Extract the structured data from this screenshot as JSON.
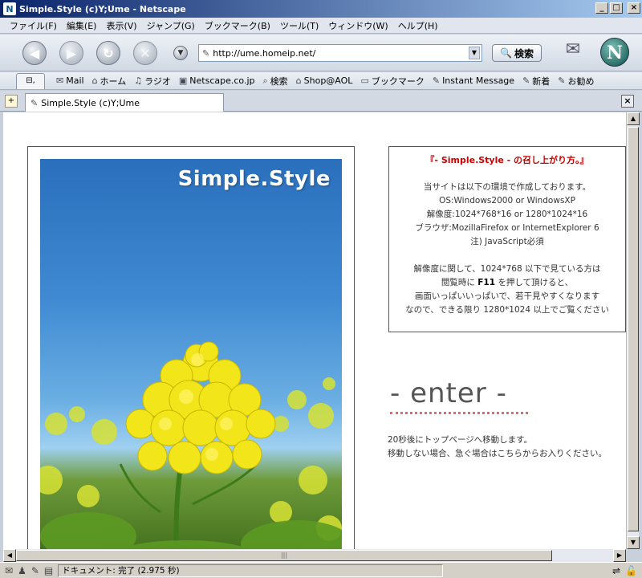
{
  "window": {
    "title": "Simple.Style (c)Y;Ume - Netscape"
  },
  "menu": [
    "ファイル(F)",
    "編集(E)",
    "表示(V)",
    "ジャンプ(G)",
    "ブックマーク(B)",
    "ツール(T)",
    "ウィンドウ(W)",
    "ヘルプ(H)"
  ],
  "nav": {
    "url": "http://ume.homeip.net/",
    "search_label": "検索"
  },
  "personal_toolbar": [
    {
      "label": "Mail",
      "icon": "mail-icon"
    },
    {
      "label": "ホーム",
      "icon": "home-icon"
    },
    {
      "label": "ラジオ",
      "icon": "radio-icon"
    },
    {
      "label": "Netscape.co.jp",
      "icon": "my-netscape-icon"
    },
    {
      "label": "検索",
      "icon": "search-icon"
    },
    {
      "label": "Shop@AOL",
      "icon": "shop-icon"
    },
    {
      "label": "ブックマーク",
      "icon": "bookmark-folder-icon"
    },
    {
      "label": "Instant Message",
      "icon": "bookmark-icon"
    },
    {
      "label": "新着",
      "icon": "bookmark-icon"
    },
    {
      "label": "お勧め",
      "icon": "bookmark-icon"
    }
  ],
  "tab": {
    "title": "Simple.Style (c)Y;Ume"
  },
  "page": {
    "brand": "Simple.Style",
    "info_heading": "『- Simple.Style - の召し上がり方。』",
    "info_lines": [
      "当サイトは以下の環境で作成しております。",
      "OS:Windows2000 or WindowsXP",
      "解像度:1024*768*16 or 1280*1024*16",
      "ブラウザ:MozillaFirefox or InternetExplorer 6",
      "注) JavaScript必須"
    ],
    "info_note_1": "解像度に関して、1024*768 以下で見ている方は",
    "info_note_2a": "閲覧時に ",
    "info_note_2b": "F11",
    "info_note_2c": " を押して頂けると、",
    "info_note_3": "画面いっぱいいっぱいで、若干見やすくなります",
    "info_note_4": "なので、できる限り 1280*1024 以上でご覧ください",
    "enter_label": "- enter -",
    "redirect_line_1": "20秒後にトップページへ移動します。",
    "redirect_line_2": "移動しない場合、急ぐ場合はこちらからお入りください。"
  },
  "status": {
    "text": "ドキュメント: 完了 (2.975 秒)"
  }
}
